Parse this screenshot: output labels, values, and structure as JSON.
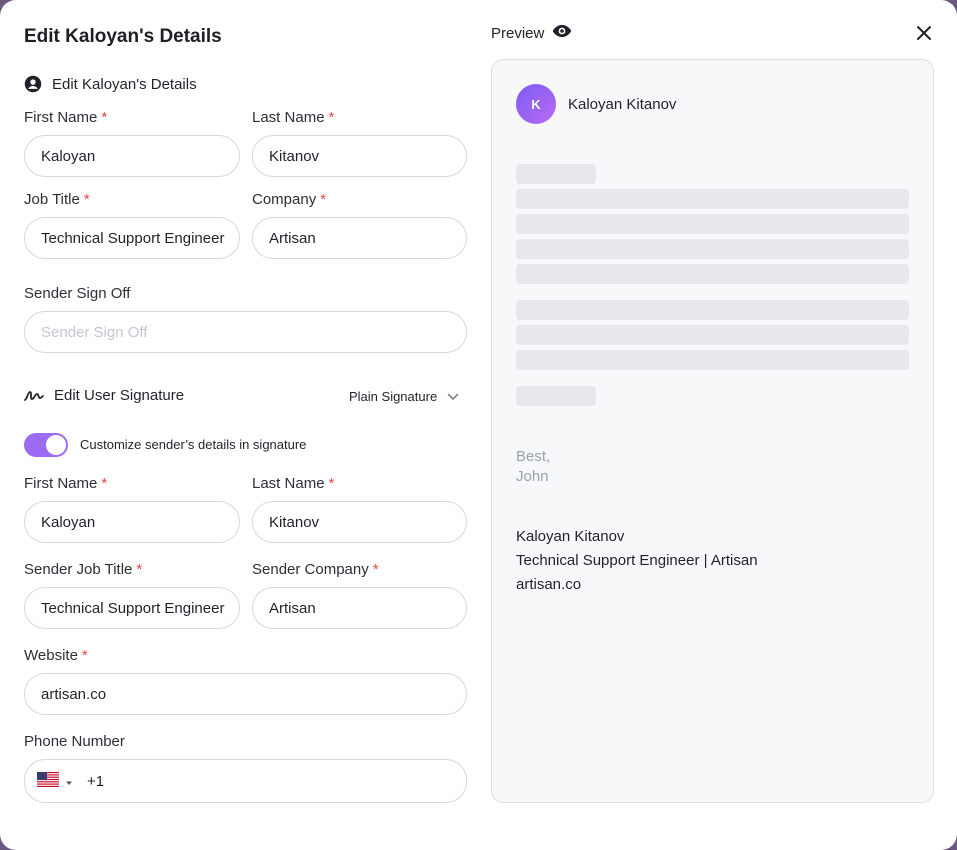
{
  "modal": {
    "title": "Edit Kaloyan's Details"
  },
  "details_section": {
    "heading": "Edit Kaloyan's Details",
    "icon": "user-circle-icon",
    "first_name": {
      "label": "First Name",
      "value": "Kaloyan"
    },
    "last_name": {
      "label": "Last Name",
      "value": "Kitanov"
    },
    "job_title": {
      "label": "Job Title",
      "value": "Technical Support Engineer"
    },
    "company": {
      "label": "Company",
      "value": "Artisan"
    },
    "sign_off": {
      "label": "Sender Sign Off",
      "placeholder": "Sender Sign Off"
    }
  },
  "signature_section": {
    "heading": "Edit User Signature",
    "icon": "signature-icon",
    "type_select": "Plain Signature",
    "toggle_label": "Customize sender’s details in signature",
    "toggle_on": true,
    "first_name": {
      "label": "First Name",
      "value": "Kaloyan"
    },
    "last_name": {
      "label": "Last Name",
      "value": "Kitanov"
    },
    "job_title": {
      "label": "Sender Job Title",
      "value": "Technical Support Engineer"
    },
    "company": {
      "label": "Sender Company",
      "value": "Artisan"
    },
    "website": {
      "label": "Website",
      "value": "artisan.co"
    },
    "phone": {
      "label": "Phone Number",
      "country": "US",
      "code": "+1"
    }
  },
  "required_mark": "*",
  "preview": {
    "title": "Preview",
    "icon": "eye-icon",
    "avatar_initial": "K",
    "sender_name": "Kaloyan Kitanov",
    "sign_off_lines": [
      "Best,",
      "John"
    ],
    "signature_lines": [
      "Kaloyan Kitanov",
      "Technical Support Engineer | Artisan",
      "artisan.co"
    ]
  },
  "colors": {
    "accent": "#9b6cf2",
    "required": "#e5484d"
  }
}
